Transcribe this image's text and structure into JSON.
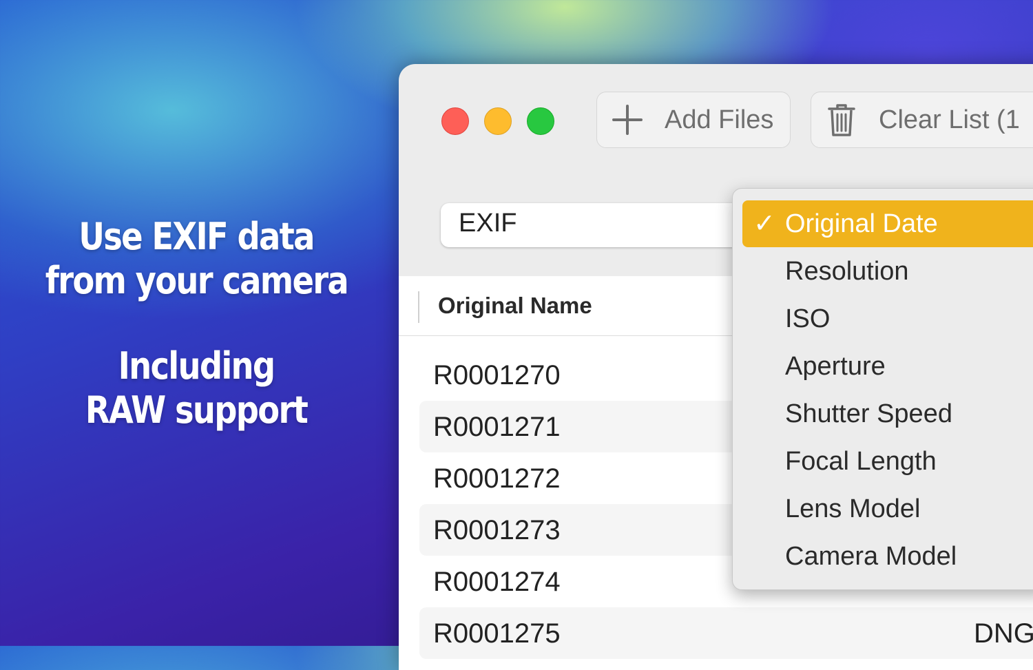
{
  "promo": {
    "line1": "Use EXIF data",
    "line2": "from your camera",
    "line3": "Including",
    "line4": "RAW support"
  },
  "toolbar": {
    "add_files_label": "Add Files",
    "clear_list_label": "Clear List (1"
  },
  "source_select": {
    "value": "EXIF"
  },
  "table": {
    "column_header": "Original Name",
    "rows": [
      {
        "name": "R0001270",
        "ext": ""
      },
      {
        "name": "R0001271",
        "ext": ""
      },
      {
        "name": "R0001272",
        "ext": ""
      },
      {
        "name": "R0001273",
        "ext": ""
      },
      {
        "name": "R0001274",
        "ext": ""
      },
      {
        "name": "R0001275",
        "ext": "DNG"
      }
    ]
  },
  "menu": {
    "check_mark": "✓",
    "items": [
      {
        "label": "Original Date",
        "selected": true
      },
      {
        "label": "Resolution"
      },
      {
        "label": "ISO"
      },
      {
        "label": "Aperture"
      },
      {
        "label": "Shutter Speed"
      },
      {
        "label": "Focal Length"
      },
      {
        "label": "Lens Model"
      },
      {
        "label": "Camera Model"
      }
    ]
  },
  "colors": {
    "accent": "#f0b31c",
    "close": "#fe5f57",
    "minimize": "#febc2e",
    "maximize": "#28c840"
  }
}
